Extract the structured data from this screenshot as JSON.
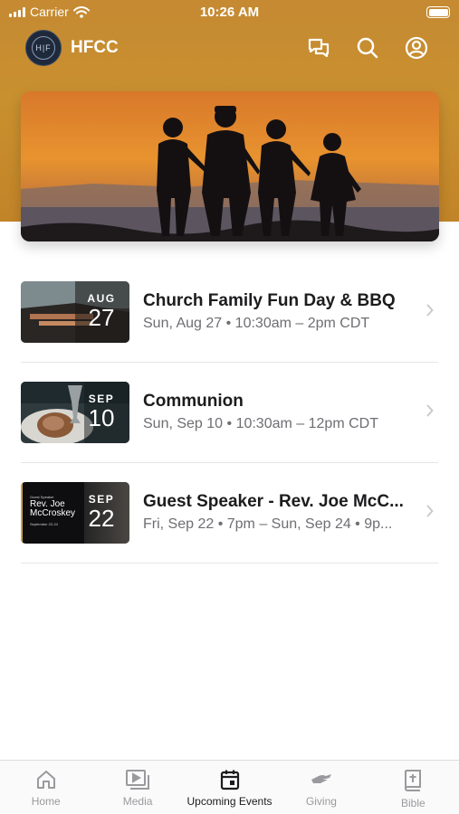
{
  "status_bar": {
    "carrier": "Carrier",
    "time": "10:26 AM"
  },
  "app_bar": {
    "logo_text": "H|F",
    "title": "HFCC"
  },
  "events": [
    {
      "month": "AUG",
      "day": "27",
      "title": "Church Family Fun Day & BBQ",
      "subtitle": "Sun, Aug 27 • 10:30am – 2pm CDT"
    },
    {
      "month": "SEP",
      "day": "10",
      "title": "Communion",
      "subtitle": "Sun, Sep 10 • 10:30am – 12pm CDT"
    },
    {
      "month": "SEP",
      "day": "22",
      "title": "Guest Speaker - Rev. Joe McC...",
      "subtitle": "Fri, Sep 22 • 7pm – Sun, Sep 24 • 9p...",
      "thumb_small": "Guest Speaker",
      "thumb_name": "Rev. Joe McCroskey",
      "thumb_dates": "September 22-24"
    }
  ],
  "tabs": [
    {
      "label": "Home",
      "icon": "home-icon"
    },
    {
      "label": "Media",
      "icon": "media-icon"
    },
    {
      "label": "Upcoming Events",
      "icon": "calendar-icon",
      "active": true
    },
    {
      "label": "Giving",
      "icon": "giving-icon"
    },
    {
      "label": "Bible",
      "icon": "bible-icon"
    }
  ],
  "colors": {
    "header": "#c58a32",
    "active_tab": "#1c1c1e",
    "inactive_tab": "#9a9a9e"
  }
}
